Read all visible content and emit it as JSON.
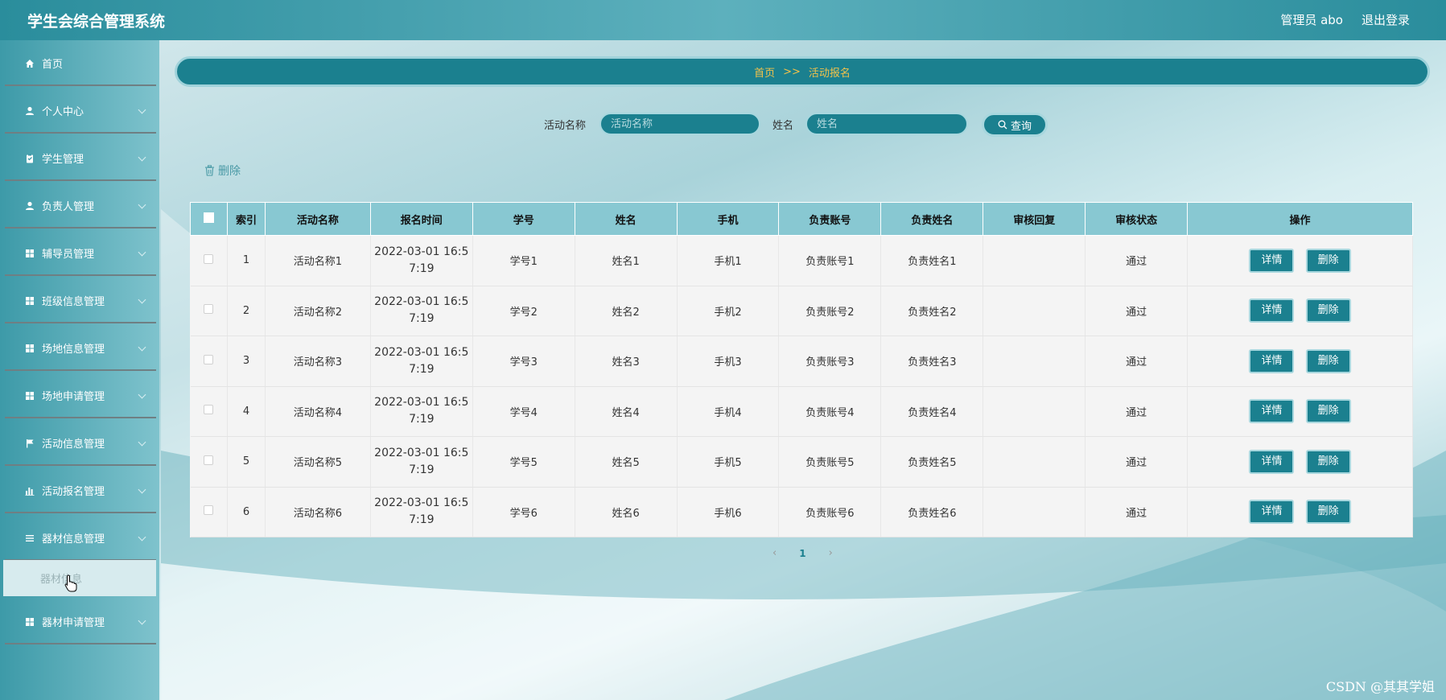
{
  "header": {
    "app_title": "学生会综合管理系统",
    "user": "管理员 abo",
    "logout": "退出登录"
  },
  "sidebar": {
    "items": [
      {
        "label": "首页",
        "icon": "home-icon",
        "expandable": false
      },
      {
        "label": "个人中心",
        "icon": "person-icon",
        "expandable": true
      },
      {
        "label": "学生管理",
        "icon": "clipboard-icon",
        "expandable": true
      },
      {
        "label": "负责人管理",
        "icon": "person-icon",
        "expandable": true
      },
      {
        "label": "辅导员管理",
        "icon": "grid-icon",
        "expandable": true
      },
      {
        "label": "班级信息管理",
        "icon": "grid-icon",
        "expandable": true
      },
      {
        "label": "场地信息管理",
        "icon": "grid-icon",
        "expandable": true
      },
      {
        "label": "场地申请管理",
        "icon": "grid-icon",
        "expandable": true
      },
      {
        "label": "活动信息管理",
        "icon": "flag-icon",
        "expandable": true
      },
      {
        "label": "活动报名管理",
        "icon": "bar-chart-icon",
        "expandable": true
      },
      {
        "label": "器材信息管理",
        "icon": "list-icon",
        "expandable": true
      },
      {
        "label": "器材申请管理",
        "icon": "grid-icon",
        "expandable": true
      }
    ],
    "submenu_item": "器材信息"
  },
  "breadcrumb": {
    "home": "首页",
    "separator": ">>",
    "current": "活动报名"
  },
  "search": {
    "activity_label": "活动名称",
    "activity_placeholder": "活动名称",
    "name_label": "姓名",
    "name_placeholder": "姓名",
    "query_button": "查询"
  },
  "toolbar": {
    "delete_label": "删除"
  },
  "table": {
    "headers": [
      "索引",
      "活动名称",
      "报名时间",
      "学号",
      "姓名",
      "手机",
      "负责账号",
      "负责姓名",
      "审核回复",
      "审核状态",
      "操作"
    ],
    "rows": [
      {
        "index": "1",
        "activity": "活动名称1",
        "time_a": "2022-03-01 16:5",
        "time_b": "7:19",
        "student_no": "学号1",
        "name": "姓名1",
        "phone": "手机1",
        "account": "负责账号1",
        "owner": "负责姓名1",
        "reply": "",
        "status": "通过"
      },
      {
        "index": "2",
        "activity": "活动名称2",
        "time_a": "2022-03-01 16:5",
        "time_b": "7:19",
        "student_no": "学号2",
        "name": "姓名2",
        "phone": "手机2",
        "account": "负责账号2",
        "owner": "负责姓名2",
        "reply": "",
        "status": "通过"
      },
      {
        "index": "3",
        "activity": "活动名称3",
        "time_a": "2022-03-01 16:5",
        "time_b": "7:19",
        "student_no": "学号3",
        "name": "姓名3",
        "phone": "手机3",
        "account": "负责账号3",
        "owner": "负责姓名3",
        "reply": "",
        "status": "通过"
      },
      {
        "index": "4",
        "activity": "活动名称4",
        "time_a": "2022-03-01 16:5",
        "time_b": "7:19",
        "student_no": "学号4",
        "name": "姓名4",
        "phone": "手机4",
        "account": "负责账号4",
        "owner": "负责姓名4",
        "reply": "",
        "status": "通过"
      },
      {
        "index": "5",
        "activity": "活动名称5",
        "time_a": "2022-03-01 16:5",
        "time_b": "7:19",
        "student_no": "学号5",
        "name": "姓名5",
        "phone": "手机5",
        "account": "负责账号5",
        "owner": "负责姓名5",
        "reply": "",
        "status": "通过"
      },
      {
        "index": "6",
        "activity": "活动名称6",
        "time_a": "2022-03-01 16:5",
        "time_b": "7:19",
        "student_no": "学号6",
        "name": "姓名6",
        "phone": "手机6",
        "account": "负责账号6",
        "owner": "负责姓名6",
        "reply": "",
        "status": "通过"
      }
    ],
    "detail_button": "详情",
    "delete_button": "删除"
  },
  "pagination": {
    "current_page": "1"
  },
  "watermark": "CSDN @其其学姐"
}
